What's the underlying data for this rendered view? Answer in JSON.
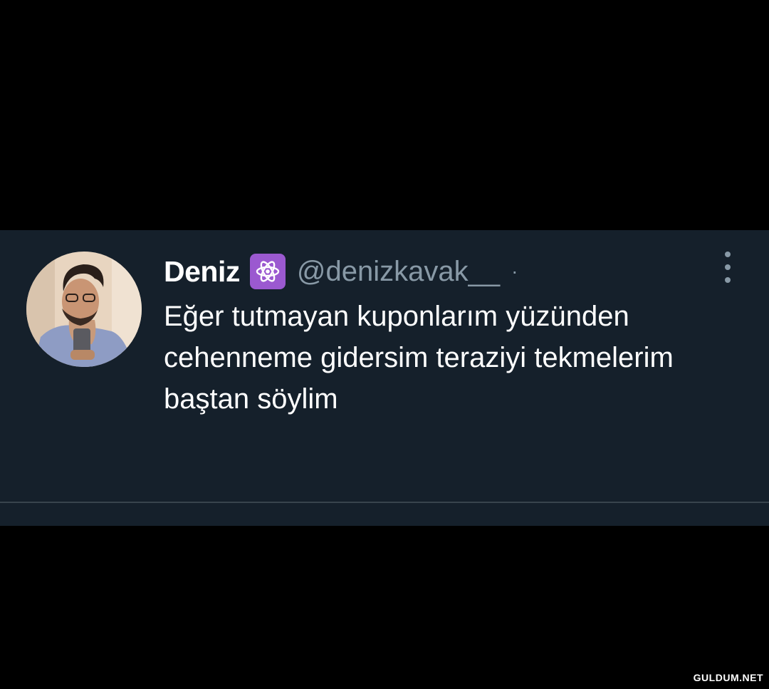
{
  "tweet": {
    "display_name": "Deniz",
    "badge_icon": "atom-icon",
    "handle": "@denizkavak__",
    "separator": "·",
    "more_icon": "more-vertical-icon",
    "text_lines": [
      "Eğer tutmayan kuponlarım yüzünden",
      "cehenneme gidersim teraziyi tekmelerim",
      "baştan söylim"
    ]
  },
  "colors": {
    "background": "#000000",
    "card_background": "#15202b",
    "primary_text": "#ffffff",
    "secondary_text": "#8899a6",
    "badge": "#9b59d0",
    "divider": "#38444d"
  },
  "watermark": "GULDUM.NET"
}
